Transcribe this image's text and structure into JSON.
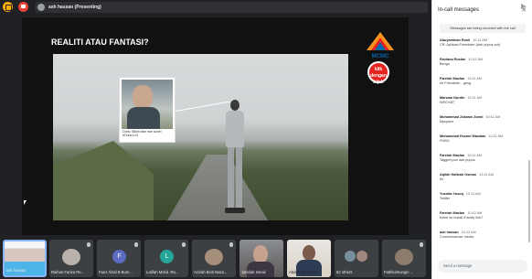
{
  "header": {
    "presenter_text": "ash hassan (Presenting)"
  },
  "slide": {
    "title": "REALITI ATAU FANTASI?",
    "logo_text": "MCMC",
    "badge_text": "klik dengan bijak",
    "inset_caption_line1": "Chris: 58km bike ride done!",
    "inset_caption_line2": "#Chris's IG"
  },
  "participants": [
    {
      "name": "ash hassan",
      "type": "self"
    },
    {
      "name": "Raihan Fariza Re...",
      "type": "face"
    },
    {
      "name": "Faez Afzal B Bum...",
      "type": "initial",
      "initial": "F",
      "color": "#5c6bc0"
    },
    {
      "name": "Latifah Mohd. Ra...",
      "type": "initial",
      "initial": "L",
      "color": "#26a69a"
    },
    {
      "name": "Azizah Binti Naza...",
      "type": "face"
    },
    {
      "name": "Jamilah Ismail",
      "type": "cam"
    },
    {
      "name": "Abdurrahman Ro...",
      "type": "cam2"
    },
    {
      "name": "82 others",
      "type": "others"
    },
    {
      "name": "Fatkhulmungin ...",
      "type": "face"
    }
  ],
  "chat": {
    "title": "In-call messages",
    "notice": "Messages are being recorded with the call",
    "messages": [
      {
        "who": "Abuyaminan Rosli",
        "time": "10:11 AM",
        "text": "CR: Aplikasi Friendster (dah pupus kot)"
      },
      {
        "who": "Roziana Roslan",
        "time": "10:11 AM",
        "text": "Bengo"
      },
      {
        "who": "Farelah Mazlan",
        "time": "10:11 AM",
        "text": "eh Friendster - geng"
      },
      {
        "who": "Marwan Nordin",
        "time": "10:11 AM",
        "text": "WECHAT"
      },
      {
        "who": "Mohammad Zakwan Zamri",
        "time": "10:11 AM",
        "text": "Myspace"
      },
      {
        "who": "Mohammad Ezamri Mazalan",
        "time": "10:11 AM",
        "text": "PUBG"
      },
      {
        "who": "Farelah Mazlan",
        "time": "10:11 AM",
        "text": "Tagged pun dah pupus"
      },
      {
        "who": "Aqilah Hafizah Osman",
        "time": "10:11 AM",
        "text": "Ini"
      },
      {
        "who": "Yusnita Yusoq",
        "time": "10:11 AM",
        "text": "Twitter"
      },
      {
        "who": "Farelah Mazlan",
        "time": "10:12 AM",
        "text": "boleh ke install iFamily link?"
      },
      {
        "who": "ash hassan",
        "time": "10:12 AM",
        "text": "Commonsense media"
      }
    ],
    "input_placeholder": "Send a message"
  }
}
